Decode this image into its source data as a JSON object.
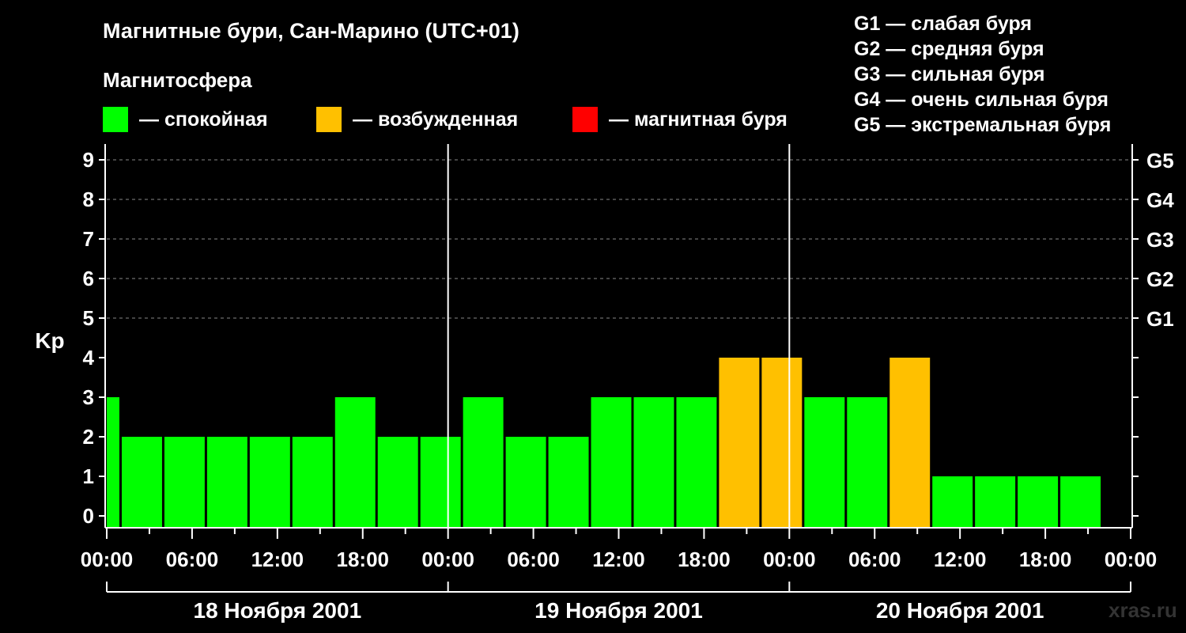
{
  "title": "Магнитные бури, Сан-Марино (UTC+01)",
  "subtitle": "Магнитосфера",
  "legend": [
    {
      "label": "— спокойная",
      "color": "#00ff00"
    },
    {
      "label": "— возбужденная",
      "color": "#ffc000"
    },
    {
      "label": "— магнитная буря",
      "color": "#ff0000"
    }
  ],
  "g_scale": [
    "G1 — слабая буря",
    "G2 — средняя буря",
    "G3 — сильная буря",
    "G4 — очень сильная буря",
    "G5 — экстремальная буря"
  ],
  "watermark": "xras.ru",
  "colors": {
    "quiet": "#00ff00",
    "active": "#ffc000",
    "storm": "#ff0000",
    "background": "#000000",
    "grid": "#888888"
  },
  "chart_data": {
    "type": "bar",
    "ylabel": "Kp",
    "ylim": [
      0,
      9
    ],
    "yticks": [
      0,
      1,
      2,
      3,
      4,
      5,
      6,
      7,
      8,
      9
    ],
    "right_ticks": [
      {
        "value": 5,
        "label": "G1"
      },
      {
        "value": 6,
        "label": "G2"
      },
      {
        "value": 7,
        "label": "G3"
      },
      {
        "value": 8,
        "label": "G4"
      },
      {
        "value": 9,
        "label": "G5"
      }
    ],
    "grid": true,
    "x_range_hours": [
      0,
      72
    ],
    "xtick_labels": [
      "00:00",
      "06:00",
      "12:00",
      "18:00",
      "00:00",
      "06:00",
      "12:00",
      "18:00",
      "00:00",
      "06:00",
      "12:00",
      "18:00",
      "00:00"
    ],
    "day_labels": [
      "18 Ноября 2001",
      "19 Ноября 2001",
      "20 Ноября 2001"
    ],
    "series": [
      {
        "bars": [
          {
            "start": 0,
            "end": 1,
            "kp": 3,
            "level": "quiet"
          },
          {
            "start": 1,
            "end": 4,
            "kp": 2,
            "level": "quiet"
          },
          {
            "start": 4,
            "end": 7,
            "kp": 2,
            "level": "quiet"
          },
          {
            "start": 7,
            "end": 10,
            "kp": 2,
            "level": "quiet"
          },
          {
            "start": 10,
            "end": 13,
            "kp": 2,
            "level": "quiet"
          },
          {
            "start": 13,
            "end": 16,
            "kp": 2,
            "level": "quiet"
          },
          {
            "start": 16,
            "end": 19,
            "kp": 3,
            "level": "quiet"
          },
          {
            "start": 19,
            "end": 22,
            "kp": 2,
            "level": "quiet"
          },
          {
            "start": 22,
            "end": 25,
            "kp": 2,
            "level": "quiet"
          },
          {
            "start": 25,
            "end": 28,
            "kp": 3,
            "level": "quiet"
          },
          {
            "start": 28,
            "end": 31,
            "kp": 2,
            "level": "quiet"
          },
          {
            "start": 31,
            "end": 34,
            "kp": 2,
            "level": "quiet"
          },
          {
            "start": 34,
            "end": 37,
            "kp": 3,
            "level": "quiet"
          },
          {
            "start": 37,
            "end": 40,
            "kp": 3,
            "level": "quiet"
          },
          {
            "start": 40,
            "end": 43,
            "kp": 3,
            "level": "quiet"
          },
          {
            "start": 43,
            "end": 46,
            "kp": 4,
            "level": "active"
          },
          {
            "start": 46,
            "end": 49,
            "kp": 4,
            "level": "active"
          },
          {
            "start": 49,
            "end": 52,
            "kp": 3,
            "level": "quiet"
          },
          {
            "start": 52,
            "end": 55,
            "kp": 3,
            "level": "quiet"
          },
          {
            "start": 55,
            "end": 58,
            "kp": 4,
            "level": "active"
          },
          {
            "start": 58,
            "end": 61,
            "kp": 1,
            "level": "quiet"
          },
          {
            "start": 61,
            "end": 64,
            "kp": 1,
            "level": "quiet"
          },
          {
            "start": 64,
            "end": 67,
            "kp": 1,
            "level": "quiet"
          },
          {
            "start": 67,
            "end": 70,
            "kp": 1,
            "level": "quiet"
          }
        ]
      }
    ]
  }
}
